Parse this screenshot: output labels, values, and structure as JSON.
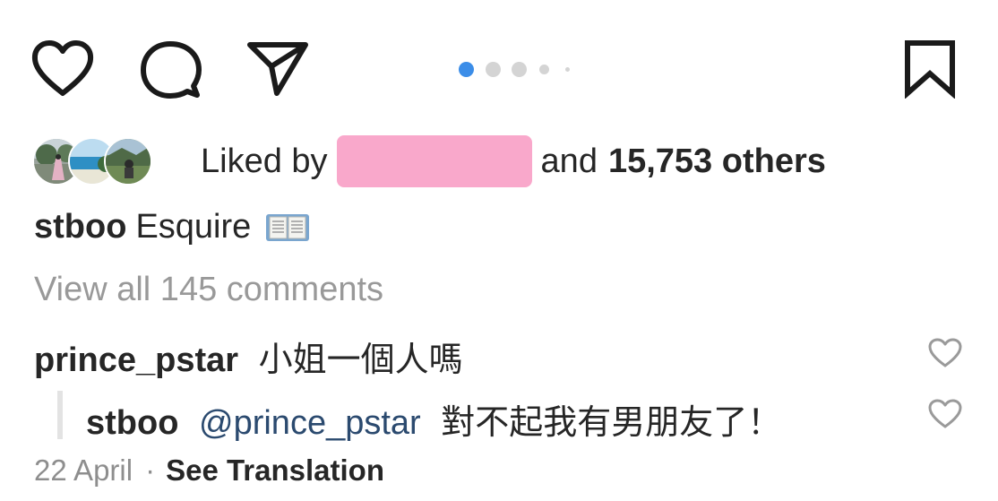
{
  "actions": {
    "like_icon": "heart-icon",
    "comment_icon": "comment-bubble-icon",
    "share_icon": "paper-plane-icon",
    "save_icon": "bookmark-icon"
  },
  "carousel": {
    "dot_count": 5,
    "active_index": 0,
    "active_color": "#3b8de8",
    "inactive_color": "#d4d4d4"
  },
  "likes": {
    "prefix": "Liked by",
    "conjunction": "and",
    "count_text": "15,753 others",
    "redaction_color": "#f9a8cb"
  },
  "caption": {
    "username": "stboo",
    "text": "Esquire",
    "emoji_icon": "open-book-icon"
  },
  "view_comments": "View all 145 comments",
  "comments": [
    {
      "username": "prince_pstar",
      "text": "小姐一個人嗎"
    }
  ],
  "reply": {
    "username": "stboo",
    "mention": "@prince_pstar",
    "text": "對不起我有男朋友了！"
  },
  "meta": {
    "date": "22 April",
    "separator": "·",
    "translation_link": "See Translation"
  }
}
